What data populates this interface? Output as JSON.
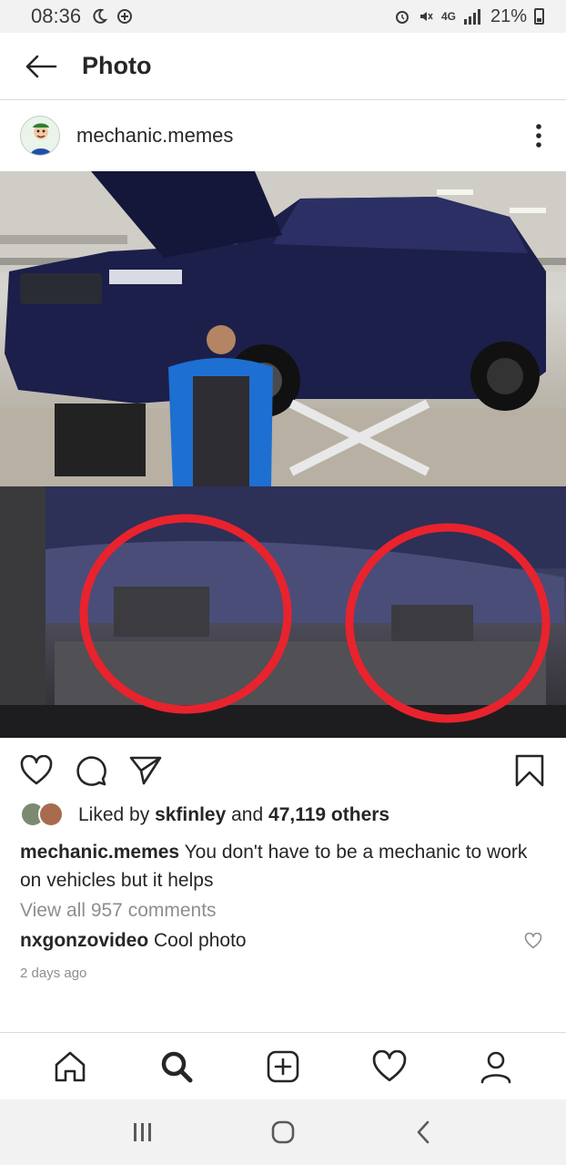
{
  "status_bar": {
    "time": "08:36",
    "network": "4G",
    "battery": "21%"
  },
  "header": {
    "title": "Photo"
  },
  "post": {
    "username": "mechanic.memes",
    "likes": {
      "prefix": "Liked by",
      "user": "skfinley",
      "joiner": "and",
      "count": "47,119 others"
    },
    "caption": {
      "username": "mechanic.memes",
      "text": "You don't have to be a mechanic to work on vehicles but it helps"
    },
    "view_comments": "View all 957 comments",
    "comment": {
      "username": "nxgonzovideo",
      "text": "Cool photo"
    },
    "timestamp": "2 days ago"
  },
  "icons": {
    "back": "back-arrow-icon",
    "more": "more-vertical-icon",
    "like": "heart-icon",
    "comment": "comment-bubble-icon",
    "share": "paper-plane-icon",
    "save": "bookmark-icon",
    "nav_home": "home-icon",
    "nav_search": "search-icon",
    "nav_add": "add-post-icon",
    "nav_activity": "heart-icon",
    "nav_profile": "profile-icon"
  },
  "colors": {
    "text": "#262626",
    "muted": "#8e8e8e",
    "divider": "#dbdbdb",
    "highlight_circle": "#e8232e"
  }
}
